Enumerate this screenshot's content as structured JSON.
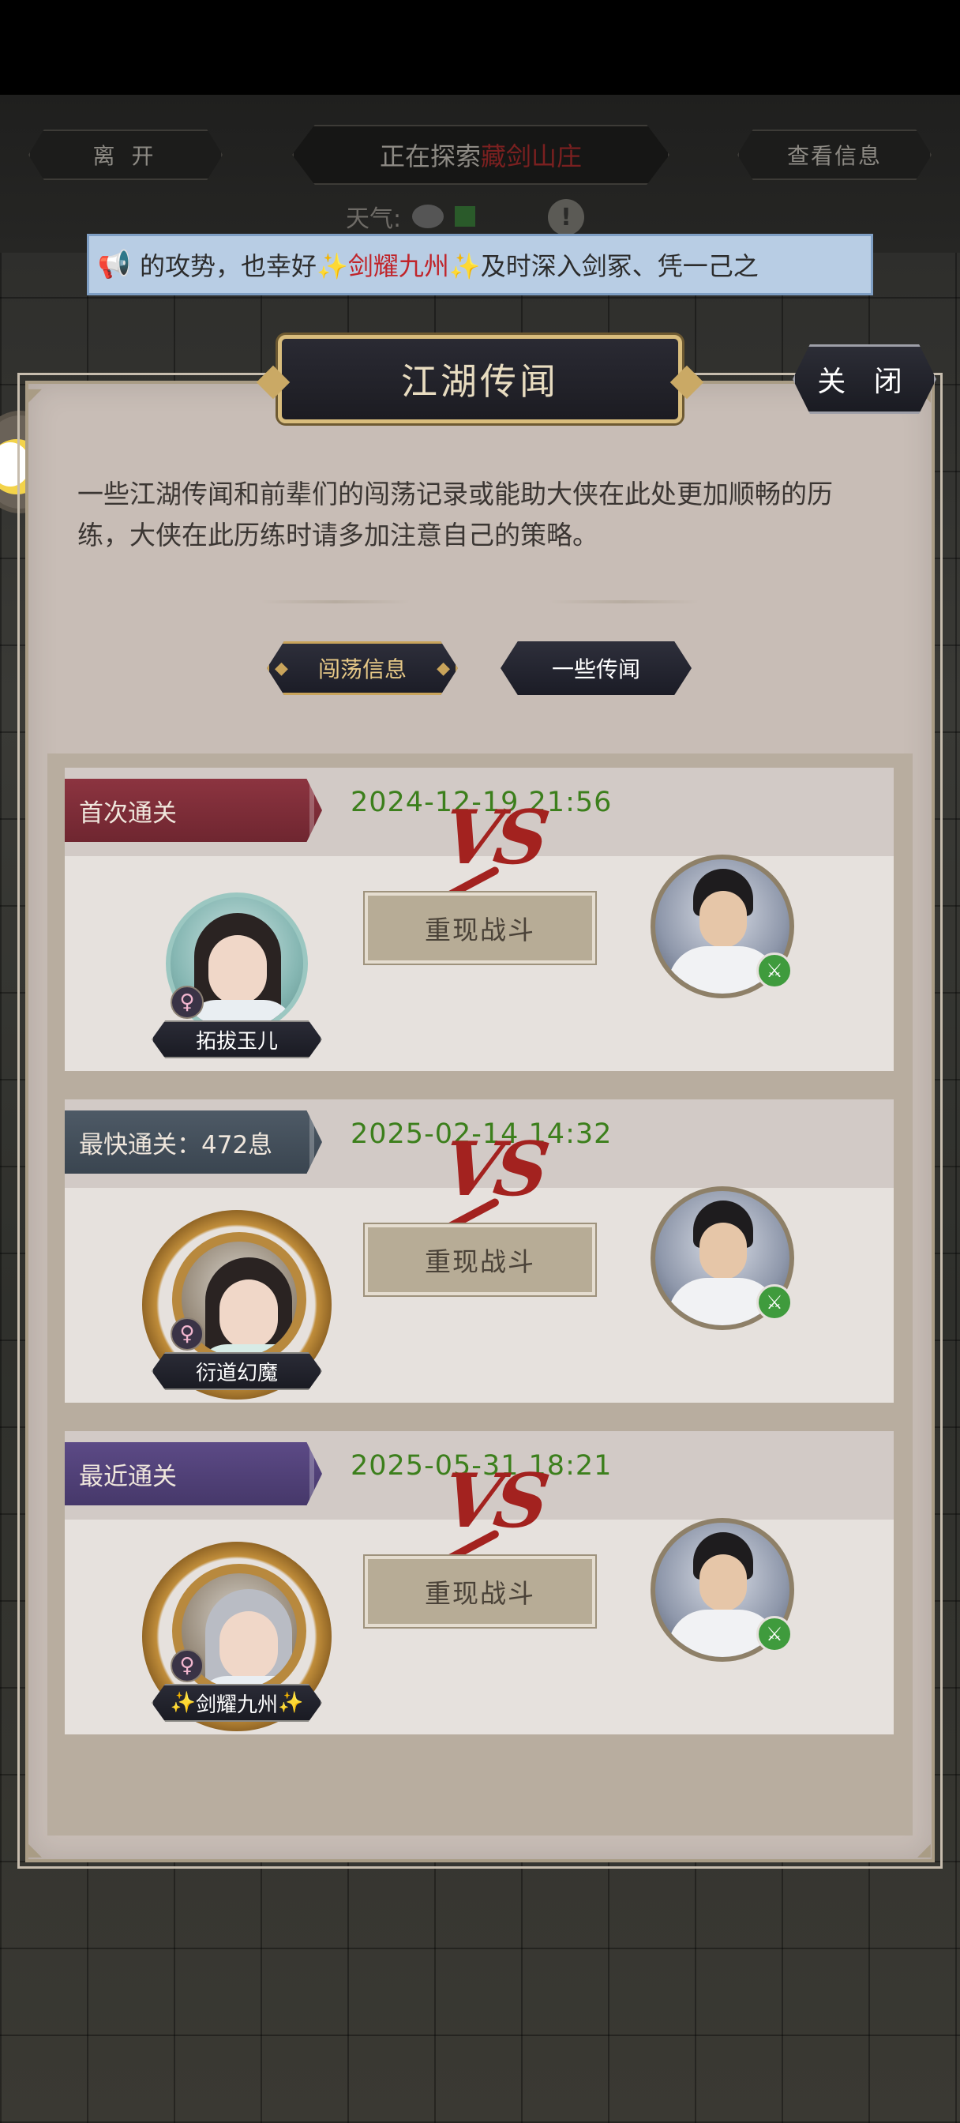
{
  "header": {
    "leave_label": "离 开",
    "explore_prefix": "正在探索",
    "explore_location": "藏剑山庄",
    "view_info_label": "查看信息",
    "weather_label": "天气:",
    "alert_glyph": "!"
  },
  "marquee": {
    "icon": "megaphone-icon",
    "text_part1": "的攻势，也幸好",
    "sparkle_left": "✨",
    "highlight": "剑耀九州",
    "sparkle_right": "✨",
    "text_part2": "及时深入剑冢、凭一己之"
  },
  "panel": {
    "title": "江湖传闻",
    "close_label": "关 闭",
    "description": "一些江湖传闻和前辈们的闯荡记录或能助大侠在此处更加顺畅的历练，大侠在此历练时请多加注意自己的策略。",
    "tabs": [
      {
        "label": "闯荡信息",
        "active": true
      },
      {
        "label": "一些传闻",
        "active": false
      }
    ]
  },
  "records": [
    {
      "label": "首次通关",
      "label_color": "#7d2e38",
      "date": "2024-12-19 21:56",
      "player_name": "拓拔玉儿",
      "name_has_sparkles": false,
      "gender_glyph": "♀",
      "frame": "teal",
      "vs": "VS",
      "replay_label": "重现战斗"
    },
    {
      "label": "最快通关：472息",
      "label_color": "#465260",
      "date": "2025-02-14 14:32",
      "player_name": "衍道幻魔",
      "name_has_sparkles": false,
      "gender_glyph": "♀",
      "frame": "gold",
      "vs": "VS",
      "replay_label": "重现战斗"
    },
    {
      "label": "最近通关",
      "label_color": "#523f78",
      "date": "2025-05-31 18:21",
      "player_name": "剑耀九州",
      "name_has_sparkles": true,
      "gender_glyph": "♀",
      "frame": "gold",
      "vs": "VS",
      "replay_label": "重现战斗"
    }
  ],
  "colors": {
    "date_green": "#3c7f1c",
    "vs_red": "#a3221f",
    "panel_bg": "#c8bdb6",
    "marquee_bg": "#b8cde4"
  }
}
